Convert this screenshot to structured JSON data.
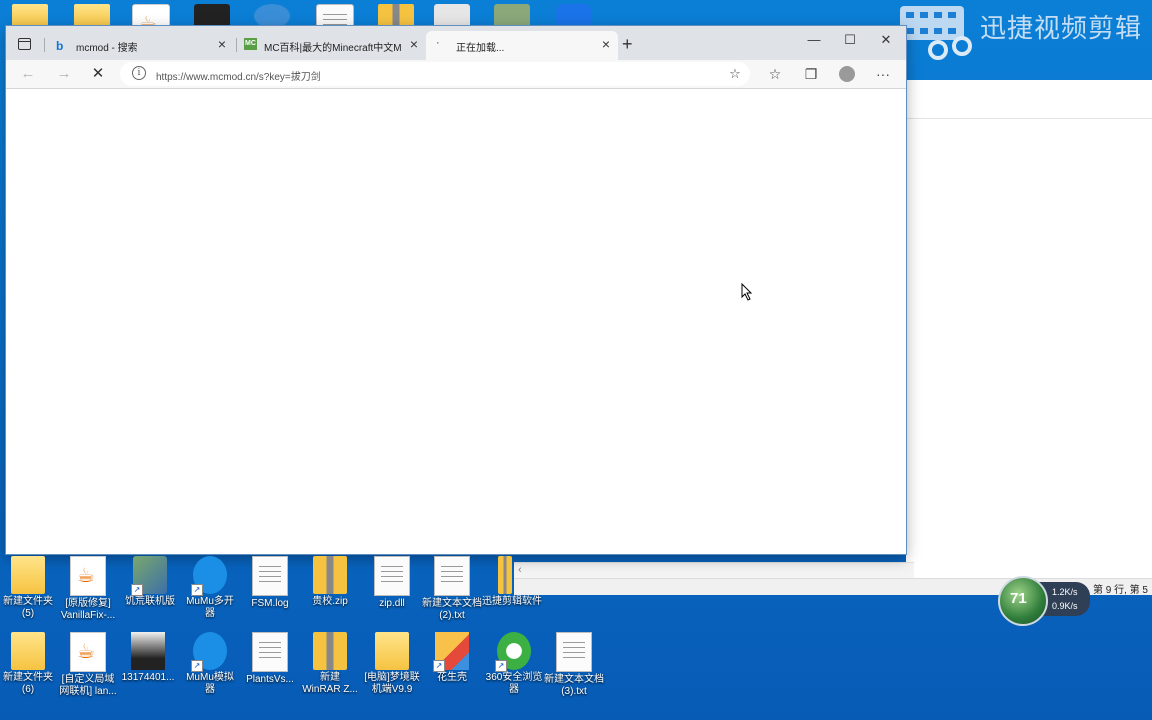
{
  "browser": {
    "tabs": [
      {
        "title": "mcmod - 搜索",
        "icon": "bing-icon"
      },
      {
        "title": "MC百科|最大的Minecraft中文MO",
        "icon": "mc-icon"
      },
      {
        "title": "正在加载...",
        "icon": "loading-icon",
        "active": true
      }
    ],
    "new_tab": "+",
    "window_controls": {
      "minimize": "—",
      "maximize": "☐",
      "close": "✕"
    },
    "address": {
      "url": "https://www.mcmod.cn/s?key=拔刀剑"
    }
  },
  "background_window": {
    "status": "第 9 行, 第 5"
  },
  "watermark": {
    "text": "迅捷视频剪辑"
  },
  "network_widget": {
    "percent": "71",
    "upload": "1.2K/s",
    "download": "0.9K/s"
  },
  "desktop_icons_row1": [
    {
      "label": "新建文件夹\n(5)",
      "type": "folder"
    },
    {
      "label": "[原版修复]\nVanillaFix-...",
      "type": "java"
    },
    {
      "label": "饥荒联机版",
      "type": "game"
    },
    {
      "label": "MuMu多开\n器",
      "type": "blueapp"
    },
    {
      "label": "FSM.log",
      "type": "doc"
    },
    {
      "label": "贵校.zip",
      "type": "zip"
    },
    {
      "label": "zip.dll",
      "type": "doc"
    },
    {
      "label": "新建文本文档\n(2).txt",
      "type": "doc"
    },
    {
      "label": "迅捷剪辑软件",
      "type": "zip"
    }
  ],
  "desktop_icons_row2": [
    {
      "label": "新建文件夹\n(6)",
      "type": "folder"
    },
    {
      "label": "[自定义局域\n网联机] lan...",
      "type": "java"
    },
    {
      "label": "13174401...",
      "type": "image"
    },
    {
      "label": "MuMu模拟\n器",
      "type": "blueapp"
    },
    {
      "label": "PlantsVs...",
      "type": "doc"
    },
    {
      "label": "新建\nWinRAR Z...",
      "type": "zip"
    },
    {
      "label": "[电脑]梦境联\n机端V9.9",
      "type": "folder"
    },
    {
      "label": "花生壳",
      "type": "cube"
    },
    {
      "label": "360安全浏览\n器",
      "type": "ie"
    },
    {
      "label": "新建文本文档\n(3).txt",
      "type": "doc"
    }
  ]
}
